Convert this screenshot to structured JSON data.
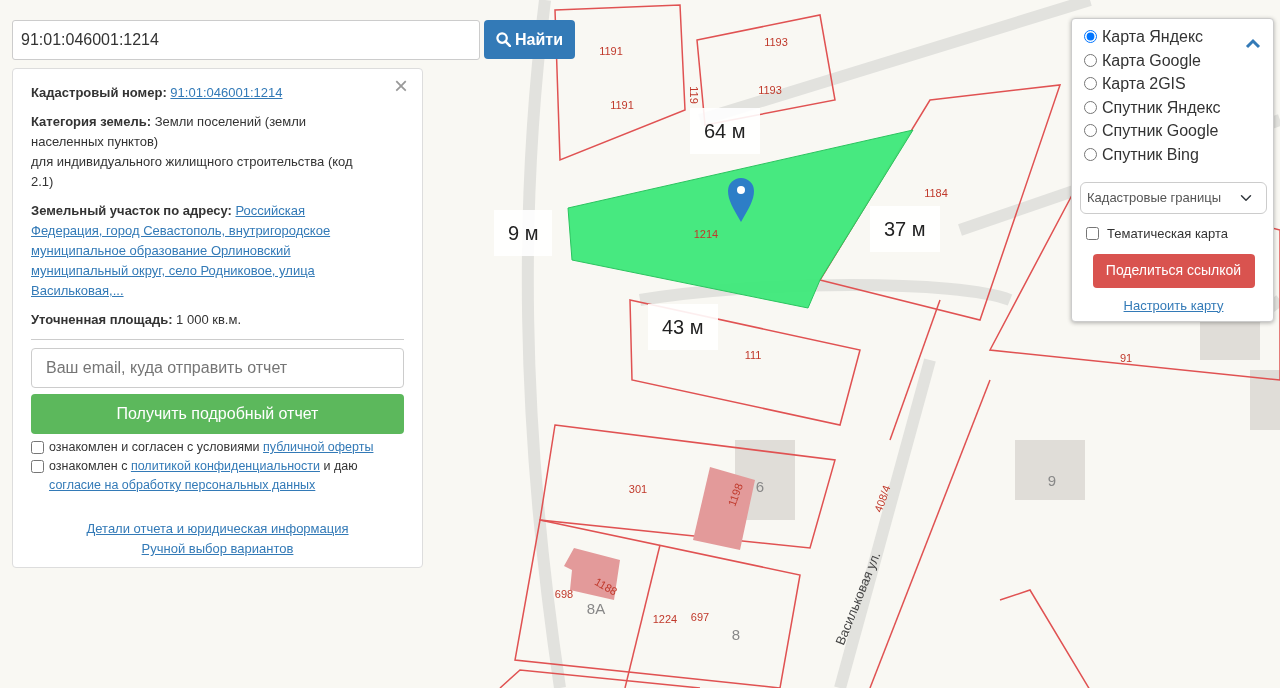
{
  "search": {
    "value": "91:01:046001:1214",
    "button": "Найти"
  },
  "info_panel": {
    "fields": [
      {
        "label": "Кадастровый номер:",
        "kind": "link",
        "lines": [
          "91:01:046001:1214"
        ]
      },
      {
        "label": "Категория земель:",
        "kind": "text",
        "lines": [
          "Земли поселений (земли",
          "населенных пунктов)",
          "для индивидуального жилищного строительства (код",
          "2.1)"
        ]
      },
      {
        "label": "Земельный участок по адресу:",
        "kind": "link",
        "lines": [
          "Российская",
          "Федерация, город Севастополь, внутригородское",
          "муниципальное образование Орлиновский",
          "муниципальный округ, село Родниковое, улица",
          "Васильковая,..."
        ]
      },
      {
        "label": "Уточненная площадь:",
        "kind": "text",
        "lines": [
          "1 000 кв.м."
        ]
      }
    ],
    "close": "×",
    "email_placeholder": "Ваш email, куда отправить отчет",
    "report_button": "Получить подробный отчет",
    "consents": [
      {
        "checked": false,
        "parts": [
          {
            "kind": "text",
            "text": "ознакомлен и согласен с условиями"
          },
          {
            "kind": "link",
            "text": "публичной оферты"
          }
        ]
      },
      {
        "checked": false,
        "parts": [
          {
            "kind": "text",
            "text": "ознакомлен с"
          },
          {
            "kind": "link",
            "text": "политикой конфиденциальности"
          },
          {
            "kind": "text",
            "text": "и даю"
          },
          {
            "kind": "link",
            "text": "согласие на обработку персональных данных"
          }
        ]
      }
    ],
    "footer_links": [
      "Детали отчета и юридическая информация",
      "Ручной выбор вариантов"
    ]
  },
  "map_controls": {
    "expanded": true,
    "layers": [
      {
        "label": "Карта Яндекс",
        "selected": true
      },
      {
        "label": "Карта Google",
        "selected": false
      },
      {
        "label": "Карта 2GIS",
        "selected": false
      },
      {
        "label": "Спутник Яндекс",
        "selected": false
      },
      {
        "label": "Спутник Google",
        "selected": false
      },
      {
        "label": "Спутник Bing",
        "selected": false
      }
    ],
    "overlay_select": "Кадастровые границы",
    "thematic": {
      "label": "Тематическая карта",
      "checked": false
    },
    "share_button": "Поделиться ссылкой",
    "settings_link": "Настроить карту"
  },
  "map": {
    "labels": [
      {
        "kind": "parcel",
        "text": "1191"
      },
      {
        "kind": "parcel",
        "text": "1193"
      },
      {
        "kind": "parcel",
        "text": "1191"
      },
      {
        "kind": "parcel",
        "text": "119"
      },
      {
        "kind": "parcel",
        "text": "1193"
      },
      {
        "kind": "parcel",
        "text": "1184"
      },
      {
        "kind": "parcel",
        "text": "1214"
      },
      {
        "kind": "parcel",
        "text": "111"
      },
      {
        "kind": "parcel",
        "text": "91"
      },
      {
        "kind": "parcel",
        "text": "301"
      },
      {
        "kind": "parcel",
        "text": "1198"
      },
      {
        "kind": "house",
        "text": "6"
      },
      {
        "kind": "house",
        "text": "9"
      },
      {
        "kind": "parcel",
        "text": "698"
      },
      {
        "kind": "house",
        "text": "8А"
      },
      {
        "kind": "parcel",
        "text": "1224"
      },
      {
        "kind": "parcel",
        "text": "697"
      },
      {
        "kind": "house",
        "text": "8"
      },
      {
        "kind": "parcel",
        "text": "408/4"
      },
      {
        "kind": "parcel",
        "text": "1188"
      },
      {
        "kind": "street",
        "text": "Васильковая ул."
      }
    ],
    "distances": [
      "64 м",
      "9 м",
      "37 м",
      "43 м"
    ]
  }
}
